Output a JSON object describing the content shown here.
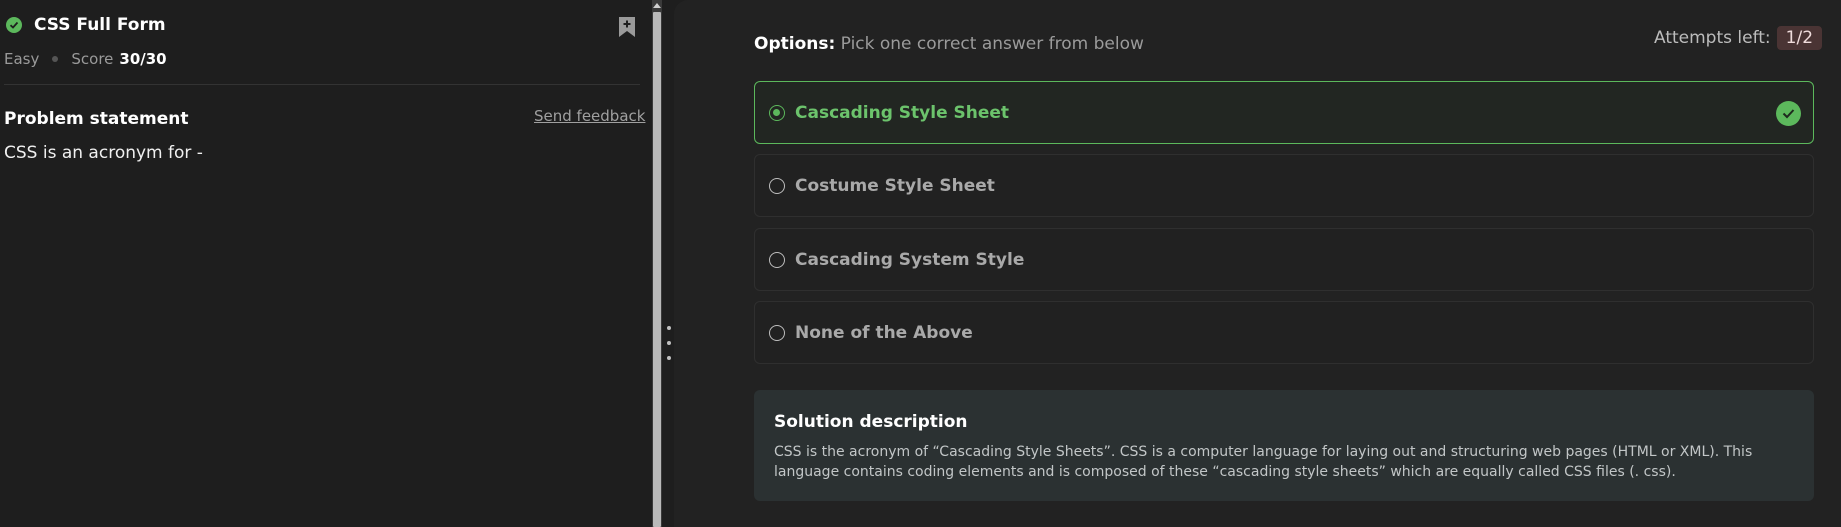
{
  "problem": {
    "title": "CSS Full Form",
    "difficulty": "Easy",
    "score_label": "Score",
    "score_value": "30/30",
    "statement_heading": "Problem statement",
    "send_feedback": "Send feedback",
    "statement_text": "CSS is an acronym for -"
  },
  "options_panel": {
    "label_bold": "Options:",
    "label_rest": " Pick one correct answer from below",
    "attempts_label": "Attempts left:",
    "attempts_value": "1/2",
    "options": [
      {
        "text": "Cascading Style Sheet",
        "selected": true,
        "correct": true
      },
      {
        "text": "Costume Style Sheet",
        "selected": false,
        "correct": false
      },
      {
        "text": "Cascading System Style",
        "selected": false,
        "correct": false
      },
      {
        "text": "None of the Above",
        "selected": false,
        "correct": false
      }
    ]
  },
  "solution": {
    "title": "Solution description",
    "text": "CSS is the acronym of “Cascading Style Sheets”. CSS is a computer language for laying out and structuring web pages (HTML or XML). This language contains coding elements and is composed of these “cascading style sheets” which are equally called CSS files (. css)."
  },
  "colors": {
    "accent_green": "#5cb85c",
    "background": "#1e1e1e",
    "panel": "#222222",
    "solution_bg": "#2b3132",
    "attempts_badge": "#4a3434"
  },
  "icons": {
    "title_status": "check-circle-icon",
    "bookmark": "bookmark-add-icon",
    "correct_mark": "check-circle-icon"
  }
}
